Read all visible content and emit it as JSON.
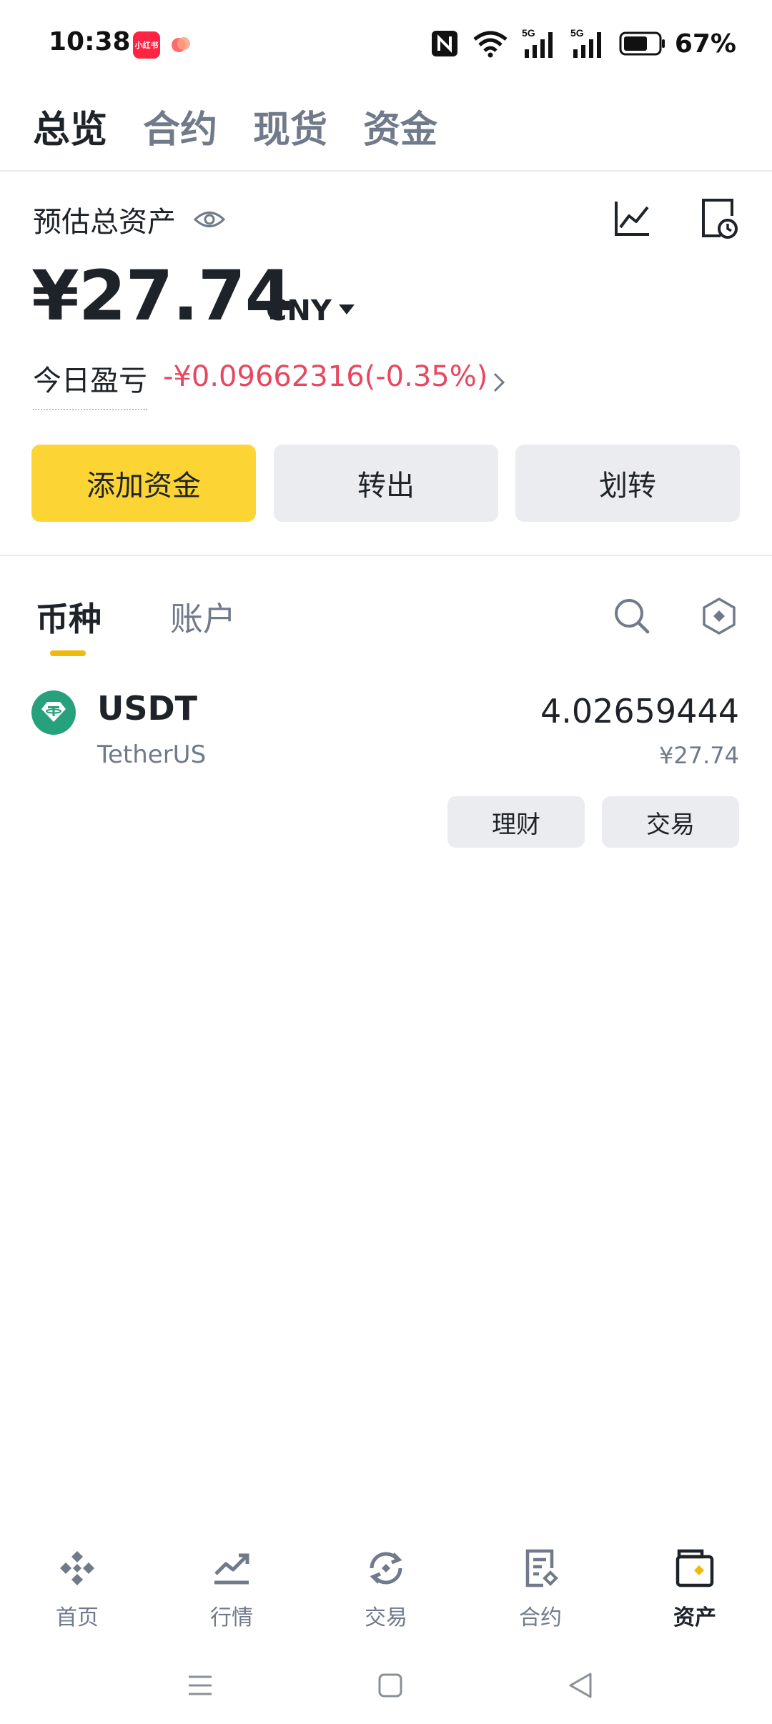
{
  "status_bar": {
    "time": "10:38",
    "app1_label": "小红书",
    "battery": "67%",
    "network": "5G"
  },
  "top_tabs": [
    {
      "label": "总览",
      "active": true
    },
    {
      "label": "合约",
      "active": false
    },
    {
      "label": "现货",
      "active": false
    },
    {
      "label": "资金",
      "active": false
    }
  ],
  "overview": {
    "estimated_label": "预估总资产",
    "total_amount": "¥27.74",
    "currency": "CNY",
    "pnl_label": "今日盈亏",
    "pnl_value": "-¥0.09662316(-0.35%)",
    "pnl_color": "#e8475f"
  },
  "actions": {
    "add_funds": "添加资金",
    "withdraw": "转出",
    "transfer": "划转"
  },
  "sub_tabs": [
    {
      "label": "币种",
      "active": true
    },
    {
      "label": "账户",
      "active": false
    }
  ],
  "assets": [
    {
      "symbol": "USDT",
      "name": "TetherUS",
      "quantity": "4.02659444",
      "fiat_value": "¥27.74",
      "earn_label": "理财",
      "trade_label": "交易"
    }
  ],
  "bottom_nav": [
    {
      "label": "首页",
      "icon": "binance-home-icon",
      "active": false
    },
    {
      "label": "行情",
      "icon": "markets-icon",
      "active": false
    },
    {
      "label": "交易",
      "icon": "trade-icon",
      "active": false
    },
    {
      "label": "合约",
      "icon": "futures-icon",
      "active": false
    },
    {
      "label": "资产",
      "icon": "wallet-icon",
      "active": true
    }
  ],
  "colors": {
    "accent": "#fcd535",
    "indicator": "#f0b90b",
    "usdt": "#26a17b",
    "secondary_button": "#eaecef",
    "muted_text": "#707a8a"
  }
}
